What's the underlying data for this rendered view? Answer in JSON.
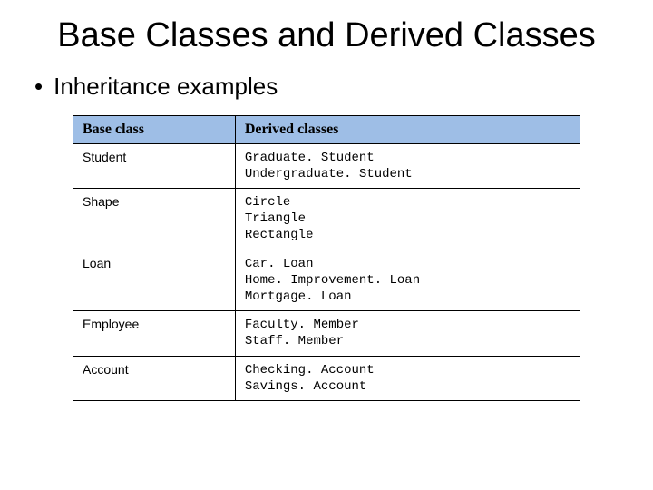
{
  "title": "Base Classes and Derived Classes",
  "bullet": "Inheritance examples",
  "headers": {
    "base": "Base class",
    "derived": "Derived classes"
  },
  "rows": [
    {
      "base": "Student",
      "derived": [
        "Graduate. Student",
        "Undergraduate. Student"
      ]
    },
    {
      "base": "Shape",
      "derived": [
        "Circle",
        "Triangle",
        "Rectangle"
      ]
    },
    {
      "base": "Loan",
      "derived": [
        "Car. Loan",
        "Home. Improvement. Loan",
        "Mortgage. Loan"
      ]
    },
    {
      "base": "Employee",
      "derived": [
        "Faculty. Member",
        "Staff. Member"
      ]
    },
    {
      "base": "Account",
      "derived": [
        "Checking. Account",
        "Savings. Account"
      ]
    }
  ]
}
